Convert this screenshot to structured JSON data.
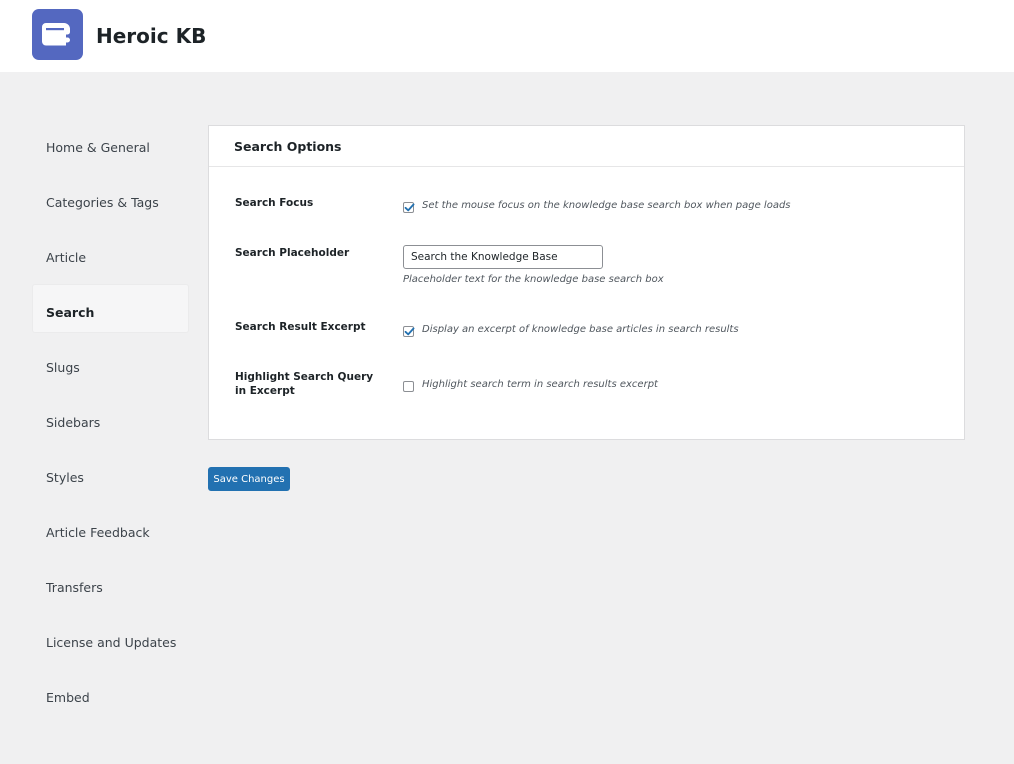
{
  "header": {
    "title": "Heroic KB",
    "logo_icon": "book-icon",
    "logo_color": "#5468c0"
  },
  "sidebar": {
    "items": [
      {
        "label": "Home & General"
      },
      {
        "label": "Categories & Tags"
      },
      {
        "label": "Article"
      },
      {
        "label": "Search",
        "active": true
      },
      {
        "label": "Slugs"
      },
      {
        "label": "Sidebars"
      },
      {
        "label": "Styles"
      },
      {
        "label": "Article Feedback"
      },
      {
        "label": "Transfers"
      },
      {
        "label": "License and Updates"
      },
      {
        "label": "Embed"
      }
    ]
  },
  "panel": {
    "title": "Search Options",
    "search_focus": {
      "label": "Search Focus",
      "checked": true,
      "description": "Set the mouse focus on the knowledge base search box when page loads"
    },
    "search_placeholder": {
      "label": "Search Placeholder",
      "value": "Search the Knowledge Base",
      "description": "Placeholder text for the knowledge base search box"
    },
    "search_result_excerpt": {
      "label": "Search Result Excerpt",
      "checked": true,
      "description": "Display an excerpt of knowledge base articles in search results"
    },
    "highlight_query": {
      "label": "Highlight Search Query in Excerpt",
      "checked": false,
      "description": "Highlight search term in search results excerpt"
    }
  },
  "actions": {
    "save_label": "Save Changes",
    "accent_color": "#2271b1"
  }
}
